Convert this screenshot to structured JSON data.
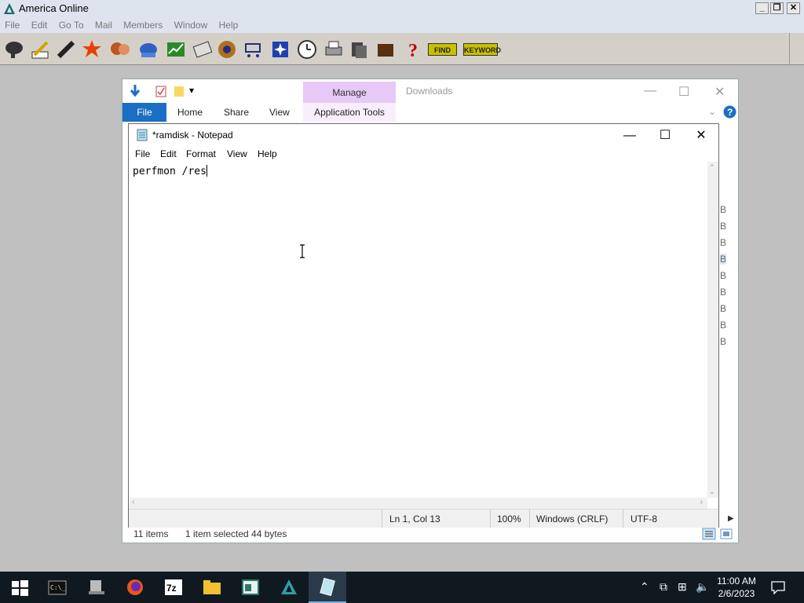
{
  "aol": {
    "title": "America  Online",
    "menu": [
      "File",
      "Edit",
      "Go To",
      "Mail",
      "Members",
      "Window",
      "Help"
    ],
    "find_label": "FIND",
    "keyword_label": "KEYWORD"
  },
  "explorer": {
    "manage_label": "Manage",
    "window_title": "Downloads",
    "tabs": {
      "file": "File",
      "home": "Home",
      "share": "Share",
      "view": "View",
      "app_tools": "Application Tools"
    },
    "status": {
      "items": "11 items",
      "selected": "1 item selected  44 bytes"
    },
    "size_suffix": "B"
  },
  "notepad": {
    "title": "*ramdisk - Notepad",
    "menu": [
      "File",
      "Edit",
      "Format",
      "View",
      "Help"
    ],
    "content": "perfmon /res",
    "status": {
      "position": "Ln 1, Col 13",
      "zoom": "100%",
      "line_ending": "Windows (CRLF)",
      "encoding": "UTF-8"
    }
  },
  "taskbar": {
    "time": "11:00 AM",
    "date": "2/6/2023"
  },
  "colors": {
    "taskbar": "#101820",
    "explorer_file_tab": "#1a6fc4",
    "manage_tab": "#e8c8f6"
  }
}
